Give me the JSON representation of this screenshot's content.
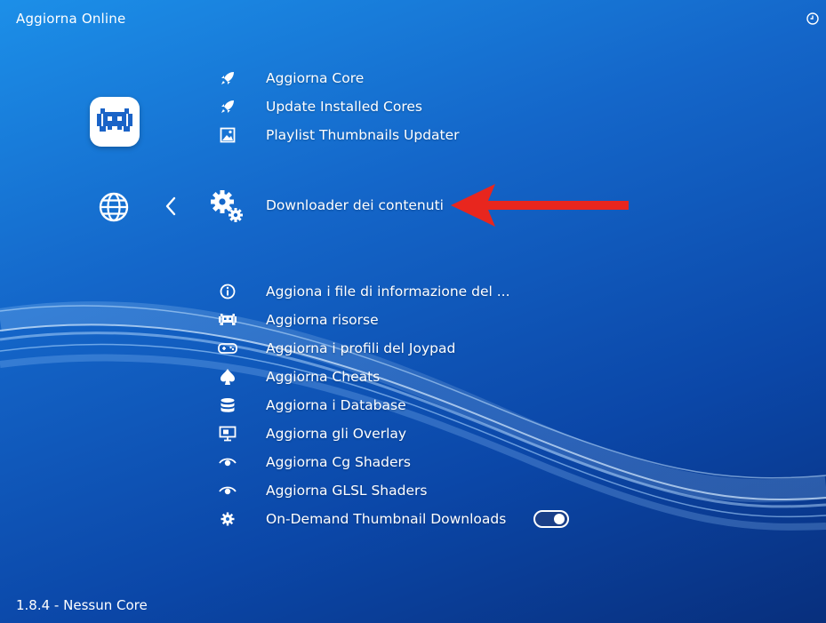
{
  "header": {
    "title": "Aggiorna Online",
    "clock_icon": "clock-icon"
  },
  "footer": {
    "version": "1.8.4 - Nessun Core"
  },
  "sidebar": {
    "logo_icon": "retroarch-invader-icon",
    "globe_icon": "globe-icon",
    "back_icon": "chevron-left-icon"
  },
  "menu": {
    "items": [
      {
        "label": "Aggiorna Core",
        "icon": "rocket-icon"
      },
      {
        "label": "Update Installed Cores",
        "icon": "rocket-icon"
      },
      {
        "label": "Playlist Thumbnails Updater",
        "icon": "image-icon"
      },
      {
        "label": "Downloader dei contenuti",
        "icon": "gears-icon",
        "selected": true
      },
      {
        "label": "Aggiona i file di informazione del ...",
        "icon": "info-icon"
      },
      {
        "label": "Aggiorna risorse",
        "icon": "invader-icon"
      },
      {
        "label": "Aggiorna i profili del Joypad",
        "icon": "gamepad-icon"
      },
      {
        "label": "Aggiorna Cheats",
        "icon": "spade-icon"
      },
      {
        "label": "Aggiorna i Database",
        "icon": "database-icon"
      },
      {
        "label": "Aggiorna gli Overlay",
        "icon": "monitor-icon"
      },
      {
        "label": "Aggiorna Cg Shaders",
        "icon": "eye-icon"
      },
      {
        "label": "Aggiorna GLSL Shaders",
        "icon": "eye-icon"
      },
      {
        "label": "On-Demand Thumbnail Downloads",
        "icon": "gear-icon",
        "toggle": true
      }
    ]
  },
  "annotation": {
    "arrow_color": "#e8261e",
    "arrow_direction": "left"
  },
  "colors": {
    "background": "#1466c9",
    "accent": "#ffffff"
  }
}
